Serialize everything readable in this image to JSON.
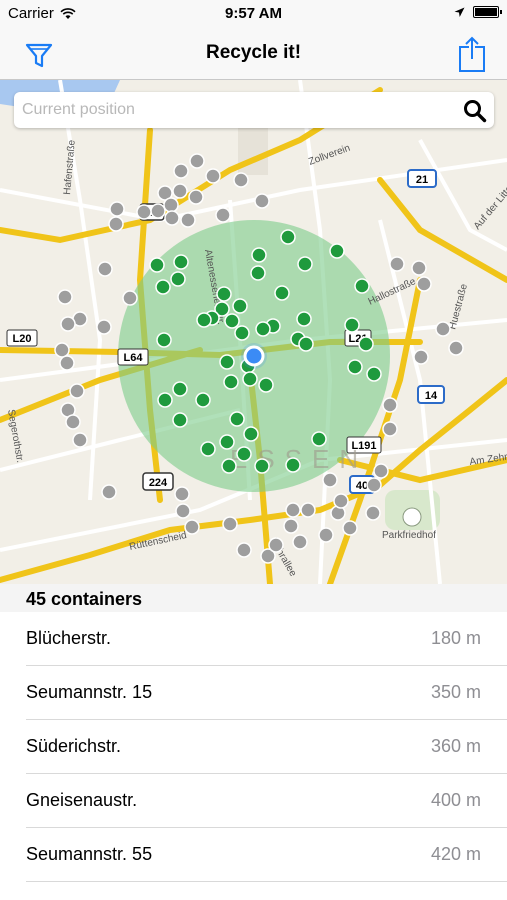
{
  "status_bar": {
    "carrier": "Carrier",
    "time": "9:57 AM"
  },
  "nav": {
    "title": "Recycle it!",
    "filter_icon": "filter-icon",
    "share_icon": "share-icon"
  },
  "search": {
    "placeholder": "Current position",
    "value": "",
    "icon": "search-icon"
  },
  "map": {
    "city_label": "ESSEN",
    "street_labels": [
      "Hafenstraße",
      "Zollverein",
      "Altenessener Str.",
      "Hallostraße",
      "Huestraße",
      "Am Zehnthof",
      "Ruhrallee",
      "Parkfriedhof",
      "Auf der Litten",
      "Segerothstr.",
      "Rüttenscheid"
    ],
    "road_badges": [
      "L20",
      "L64",
      "L191",
      "21",
      "14",
      "224",
      "40",
      "L21",
      "224"
    ],
    "accent_color": "#3b8bf5",
    "radius_color": "#7bcc8a",
    "container_color_in_range": "#1f9a3d",
    "container_color_out_of_range": "#9e9e9e"
  },
  "results": {
    "count_label": "45 containers",
    "items": [
      {
        "name": "Blücherstr.",
        "distance": "180 m"
      },
      {
        "name": "Seumannstr. 15",
        "distance": "350 m"
      },
      {
        "name": "Süderichstr.",
        "distance": "360 m"
      },
      {
        "name": "Gneisenaustr.",
        "distance": "400 m"
      },
      {
        "name": "Seumannstr. 55",
        "distance": "420 m"
      }
    ]
  }
}
